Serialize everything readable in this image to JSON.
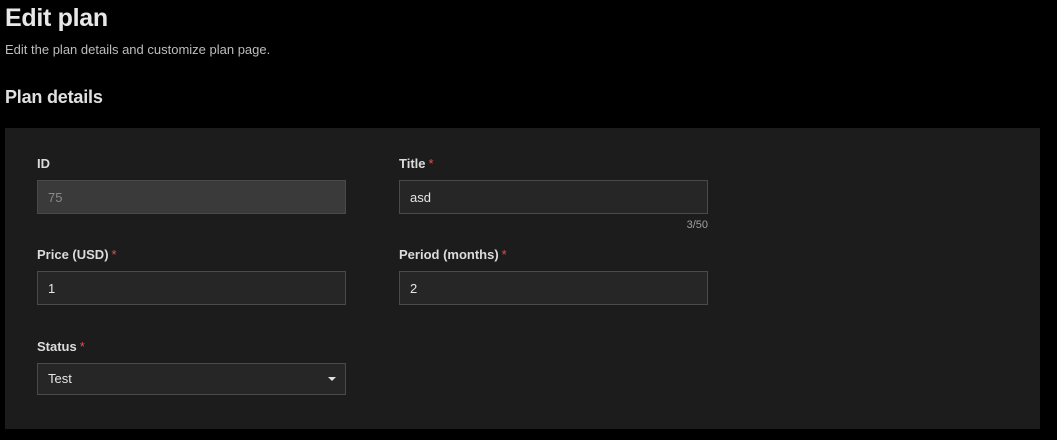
{
  "header": {
    "title": "Edit plan",
    "subtitle": "Edit the plan details and customize plan page."
  },
  "section": {
    "title": "Plan details"
  },
  "form": {
    "id": {
      "label": "ID",
      "value": "75",
      "disabled": true
    },
    "title": {
      "label": "Title",
      "required_mark": "*",
      "value": "asd",
      "counter": "3/50"
    },
    "price": {
      "label": "Price (USD)",
      "required_mark": "*",
      "value": "1"
    },
    "period": {
      "label": "Period (months)",
      "required_mark": "*",
      "value": "2"
    },
    "status": {
      "label": "Status",
      "required_mark": "*",
      "selected": "Test"
    }
  },
  "icons": {
    "status_dropdown": "caret-down-icon"
  },
  "colors": {
    "background": "#000000",
    "panel": "#1c1c1c",
    "required": "#e05151"
  }
}
